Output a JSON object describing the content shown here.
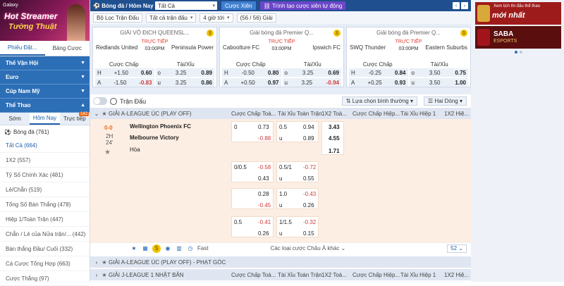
{
  "left": {
    "banner": {
      "brand": "Galaxy",
      "line1": "Hot Streamer",
      "line2": "Tường Thuật"
    },
    "tabs": [
      "Phiếu Đặt...",
      "Bảng Cược"
    ],
    "categories": [
      "Thế Vận Hội",
      "Euro",
      "Cúp Nam Mỹ",
      "Thể Thao"
    ],
    "subtabs": [
      "Sớm",
      "Hôm Nay",
      "Trực tiếp"
    ],
    "subtab_badge": "142",
    "sport": {
      "name": "Bóng đá",
      "count": "(761)"
    },
    "markets": [
      "Tất Cả (664)",
      "1X2 (557)",
      "Tỷ Số Chính Xác (481)",
      "Lẻ/Chẵn (519)",
      "Tổng Số Bàn Thắng (478)",
      "Hiệp 1/Toàn Trận (447)",
      "Chẵn / Lẻ của Nửa trận/...",
      "Bàn thắng Đầu/ Cuối (332)",
      "Cá Cược Tổng Hợp (663)",
      "Cược Thắng (97)"
    ],
    "markets_extra": "(442)"
  },
  "topbar": {
    "title": "Bóng đá / Hôm Nay",
    "select": "Tất Cả",
    "btn1": "Cược Xiên",
    "btn2": "Trình tạo cược xiên tự động"
  },
  "filters": [
    {
      "label": "Bộ Lọc Trận Đấu"
    },
    {
      "label": "Tất cả trận đấu"
    },
    {
      "label": "4 giờ tới"
    },
    {
      "label": "(56 / 56) Giải"
    }
  ],
  "cards": [
    {
      "league": "GIẢI VÔ ĐỊCH QUEENSL...",
      "home": "Redlands United",
      "away": "Peninsula Power",
      "live": "TRỰC TIẾP",
      "time": "03:00PM",
      "h1": "Cược Chấp",
      "h2": "Tài/Xỉu",
      "r1": [
        "H",
        "+1.50",
        "0.60",
        "o",
        "3.25",
        "0.89"
      ],
      "r2": [
        "A",
        "-1.50",
        "-0.83",
        "u",
        "3.25",
        "0.86"
      ]
    },
    {
      "league": "Giải bóng đá Premier Q...",
      "home": "Caboolture FC",
      "away": "Ipswich FC",
      "live": "TRỰC TIẾP",
      "time": "03:00PM",
      "h1": "Cược Chấp",
      "h2": "Tài/Xỉu",
      "r1": [
        "H",
        "-0.50",
        "0.80",
        "o",
        "3.25",
        "0.69"
      ],
      "r2": [
        "A",
        "+0.50",
        "0.97",
        "u",
        "3.25",
        "-0.94"
      ]
    },
    {
      "league": "Giải bóng đá Premier Q...",
      "home": "SWQ Thunder",
      "away": "Eastern Suburbs",
      "live": "TRỰC TIẾP",
      "time": "03:00PM",
      "h1": "Cược Chấp",
      "h2": "Tài/Xỉu",
      "r1": [
        "H",
        "-0.25",
        "0.84",
        "o",
        "3.50",
        "0.75"
      ],
      "r2": [
        "A",
        "+0.25",
        "0.93",
        "u",
        "3.50",
        "1.00"
      ]
    }
  ],
  "main": {
    "title": "Trận Đấu",
    "sort": "Lựa chọn bình thường",
    "view": "Hai Dòng",
    "columns": [
      "Cược Chấp Toà...",
      "Tài Xỉu Toàn Trận",
      "1X2 Toà...",
      "Cược Chấp Hiệp...",
      "Tài Xỉu Hiệp 1",
      "1X2 Hiệ..."
    ],
    "league1": "GIẢI A-LEAGUE ÚC (PLAY OFF)",
    "match": {
      "score": "0-0",
      "period": "2H",
      "minute": "24'",
      "home": "Wellington Phoenix FC",
      "away": "Melbourne Victory",
      "draw": "Hòa"
    },
    "rows": [
      {
        "h": "0",
        "ho": "0.73",
        "ao": "-0.88",
        "ou": "0.5",
        "oo": "0.94",
        "uo": "0.89",
        "x1": "3.43",
        "x2": "4.55",
        "x3": "1.71"
      },
      {
        "h": "0/0.5",
        "ho": "-0.58",
        "ao": "0.43",
        "ou": "0.5/1",
        "oo": "-0.72",
        "uo": "0.55"
      },
      {
        "h": "",
        "ho": "0.28",
        "ao": "-0.45",
        "ou": "1.0",
        "oo": "-0.43",
        "uo": "0.26"
      },
      {
        "h": "0.5",
        "ho": "-0.41",
        "ao": "0.26",
        "ou": "1/1.5",
        "oo": "-0.32",
        "uo": "0.15"
      }
    ],
    "more": "Các loại cược Châu Á khác",
    "count": "52",
    "fast": "Fast",
    "league2": "GIẢI A-LEAGUE ÚC (PLAY OFF) - PHẠT GÓC",
    "league3": "GIẢI J-LEAGUE 1 NHẬT BẢN"
  },
  "ads": {
    "ad1_small": "Xem lịch thi đấu thể thao",
    "ad1_big": "mới nhất",
    "ad2_big": "SABA",
    "ad2_small": "ESPORTS"
  },
  "colors": {
    "primary": "#2c6fb7",
    "topbar": "#1f4f8f",
    "odds_bg": "#fdeee3",
    "negative": "#d23b3b",
    "live": "#e0382d"
  }
}
